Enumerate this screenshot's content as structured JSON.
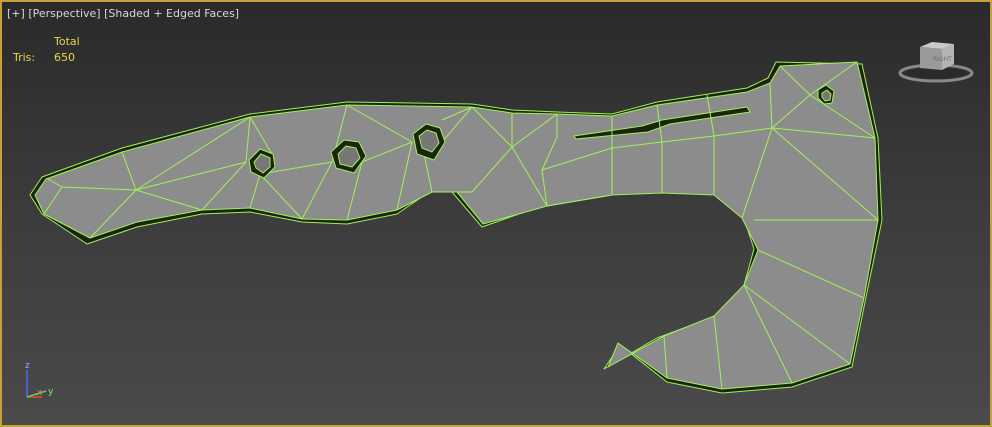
{
  "viewport": {
    "label_plus": "[+]",
    "label_view": "[Perspective]",
    "label_shading": "[Shaded + Edged Faces]",
    "border_color": "#c6a23a",
    "wire_color": "#a2f05a",
    "mesh_fill": "#8c8c8c"
  },
  "stats": {
    "header": "Total",
    "tris_label": "Tris:",
    "tris_value": "650",
    "color": "#e6d84a"
  },
  "viewcube": {
    "face_label": "RIGHT"
  },
  "axis_gizmo": {
    "z": "z",
    "x": "x",
    "y": "y"
  }
}
